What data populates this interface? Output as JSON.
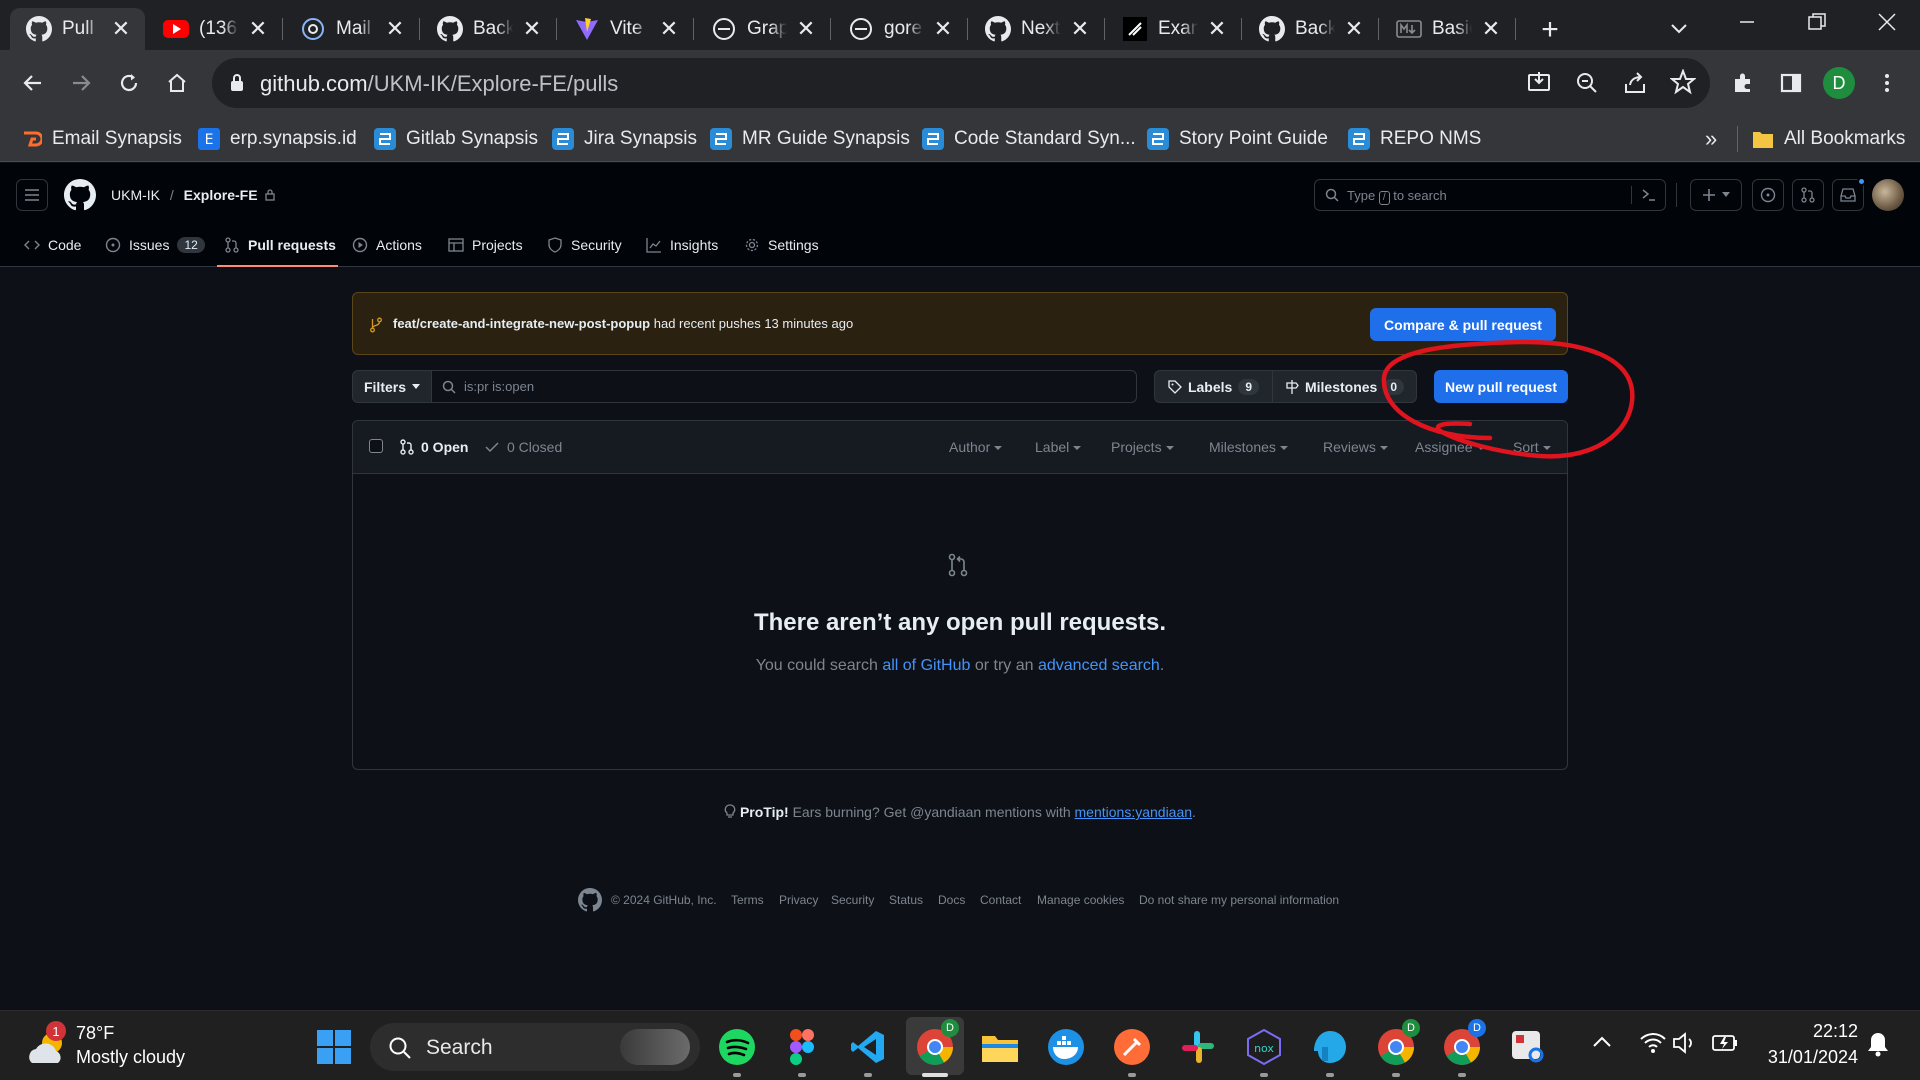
{
  "browser": {
    "tabs": [
      {
        "title": "Pull",
        "icon": "github-icon",
        "active": true
      },
      {
        "title": "(136",
        "icon": "youtube-icon"
      },
      {
        "title": "Mail",
        "icon": "mail-icon"
      },
      {
        "title": "Back",
        "icon": "github-icon"
      },
      {
        "title": "Vite",
        "icon": "vite-icon"
      },
      {
        "title": "Grap",
        "icon": "graphql-icon"
      },
      {
        "title": "gore",
        "icon": "graphql-icon"
      },
      {
        "title": "Next",
        "icon": "github-icon"
      },
      {
        "title": "Exan",
        "icon": "shadcn-icon"
      },
      {
        "title": "Back",
        "icon": "github-icon"
      },
      {
        "title": "Basic",
        "icon": "markdown-icon"
      }
    ],
    "url_host": "github.com",
    "url_path": "/UKM-IK/Explore-FE/pulls",
    "profile_initial": "D",
    "bookmarks": [
      {
        "label": "Email Synapsis",
        "icon": "cpanel-icon"
      },
      {
        "label": "erp.synapsis.id",
        "icon": "erp-icon"
      },
      {
        "label": "Gitlab Synapsis",
        "icon": "synapsis-icon"
      },
      {
        "label": "Jira Synapsis",
        "icon": "synapsis-icon"
      },
      {
        "label": "MR Guide Synapsis",
        "icon": "synapsis-icon"
      },
      {
        "label": "Code Standard Syn...",
        "icon": "synapsis-icon"
      },
      {
        "label": "Story Point Guide",
        "icon": "synapsis-icon"
      },
      {
        "label": "REPO NMS",
        "icon": "synapsis-icon"
      }
    ],
    "more_bookmarks": "»",
    "all_bookmarks": "All Bookmarks"
  },
  "github": {
    "owner": "UKM-IK",
    "separator": "/",
    "repo": "Explore-FE",
    "search_placeholder_pre": "Type",
    "search_key": "/",
    "search_placeholder_post": "to search",
    "tabs": [
      {
        "label": "Code",
        "icon": "code-icon"
      },
      {
        "label": "Issues",
        "icon": "issue-icon",
        "count": "12"
      },
      {
        "label": "Pull requests",
        "icon": "pull-request-icon",
        "active": true
      },
      {
        "label": "Actions",
        "icon": "play-icon"
      },
      {
        "label": "Projects",
        "icon": "table-icon"
      },
      {
        "label": "Security",
        "icon": "shield-icon"
      },
      {
        "label": "Insights",
        "icon": "graph-icon"
      },
      {
        "label": "Settings",
        "icon": "gear-icon"
      }
    ],
    "banner": {
      "branch": "feat/create-and-integrate-new-post-popup",
      "text": "had recent pushes 13 minutes ago",
      "button": "Compare & pull request"
    },
    "filters": {
      "button": "Filters",
      "query": "is:pr is:open",
      "labels": "Labels",
      "labels_count": "9",
      "milestones": "Milestones",
      "milestones_count": "0",
      "new_pr": "New pull request"
    },
    "list": {
      "open": "0 Open",
      "closed": "0 Closed",
      "sort_items": [
        "Author",
        "Label",
        "Projects",
        "Milestones",
        "Reviews",
        "Assignee",
        "Sort"
      ]
    },
    "empty": {
      "title": "There aren’t any open pull requests.",
      "pre": "You could search",
      "link1": "all of GitHub",
      "mid": "or try an",
      "link2": "advanced search",
      "post": "."
    },
    "protip": {
      "label": "ProTip!",
      "text": "Ears burning? Get @yandiaan mentions with",
      "link": "mentions:yandiaan",
      "post": "."
    },
    "footer": {
      "copyright": "© 2024 GitHub, Inc.",
      "links": [
        "Terms",
        "Privacy",
        "Security",
        "Status",
        "Docs",
        "Contact",
        "Manage cookies",
        "Do not share my personal information"
      ]
    }
  },
  "annotation": {
    "color": "#e0141e",
    "shape": "hand-drawn circle around New pull request button"
  },
  "taskbar": {
    "weather_temp": "78°F",
    "weather_desc": "Mostly cloudy",
    "weather_badge": "1",
    "search_label": "Search",
    "apps": [
      "windows-start-icon",
      "spotify-icon",
      "figma-icon",
      "vscode-icon",
      "chrome-icon",
      "file-explorer-icon",
      "docker-icon",
      "postman-icon",
      "slack-icon",
      "nox-icon",
      "tableplus-icon",
      "chrome-icon",
      "chrome-icon",
      "snipping-tool-icon"
    ],
    "time": "22:12",
    "date": "31/01/2024"
  },
  "colors": {
    "accent": "#1f6feb",
    "link": "#4493f8",
    "bg": "#0d1117",
    "annotation": "#e0141e"
  }
}
